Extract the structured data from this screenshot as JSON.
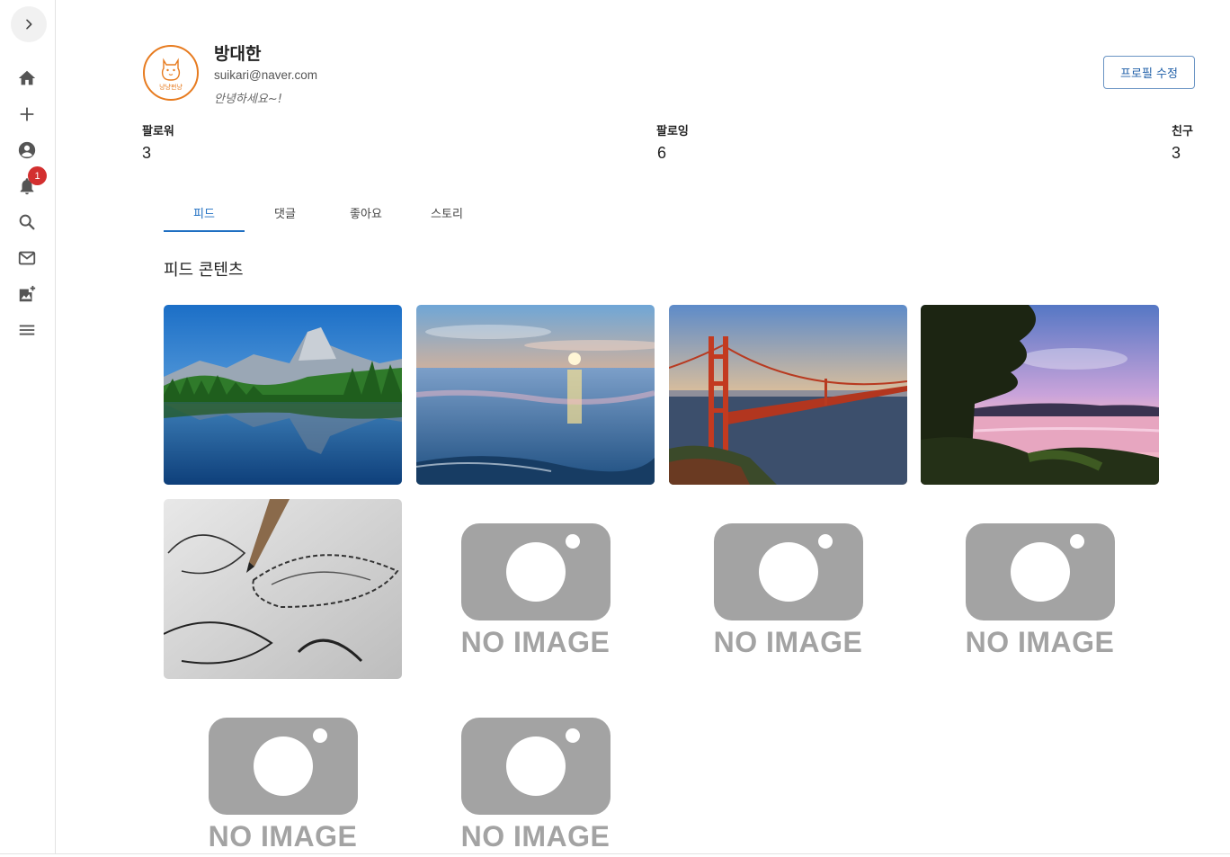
{
  "sidebar": {
    "toggle_icon": "chevron-right-icon",
    "items": [
      {
        "name": "home-icon"
      },
      {
        "name": "plus-icon"
      },
      {
        "name": "account-icon"
      },
      {
        "name": "bell-icon"
      },
      {
        "name": "search-icon"
      },
      {
        "name": "mail-icon"
      },
      {
        "name": "add-photo-icon"
      },
      {
        "name": "menu-icon"
      }
    ],
    "notification_count": "1"
  },
  "profile": {
    "avatar_text": "냥냥펀냥",
    "name": "방대한",
    "email": "suikari@naver.com",
    "bio": "안녕하세요~!",
    "edit_button": "프로필 수정"
  },
  "stats": {
    "followers_label": "팔로워",
    "followers_value": "3",
    "following_label": "팔로잉",
    "following_value": "6",
    "friends_label": "친구",
    "friends_value": "3"
  },
  "tabs": [
    "피드",
    "댓글",
    "좋아요",
    "스토리"
  ],
  "active_tab": 0,
  "section_title": "피드 콘텐츠",
  "feed": {
    "no_image_text": "NO IMAGE",
    "items": [
      {
        "type": "photo",
        "subject": "mountain-lake"
      },
      {
        "type": "photo",
        "subject": "sea-sunset"
      },
      {
        "type": "photo",
        "subject": "golden-gate-bridge"
      },
      {
        "type": "photo",
        "subject": "tree-sunset"
      },
      {
        "type": "photo",
        "subject": "pencil-sketch"
      },
      {
        "type": "placeholder"
      },
      {
        "type": "placeholder"
      },
      {
        "type": "placeholder"
      },
      {
        "type": "placeholder"
      },
      {
        "type": "placeholder"
      }
    ]
  },
  "colors": {
    "accent": "#1f6fc2",
    "badge": "#d32f2f",
    "avatar_border": "#e77b1f",
    "placeholder": "#a3a3a3"
  }
}
